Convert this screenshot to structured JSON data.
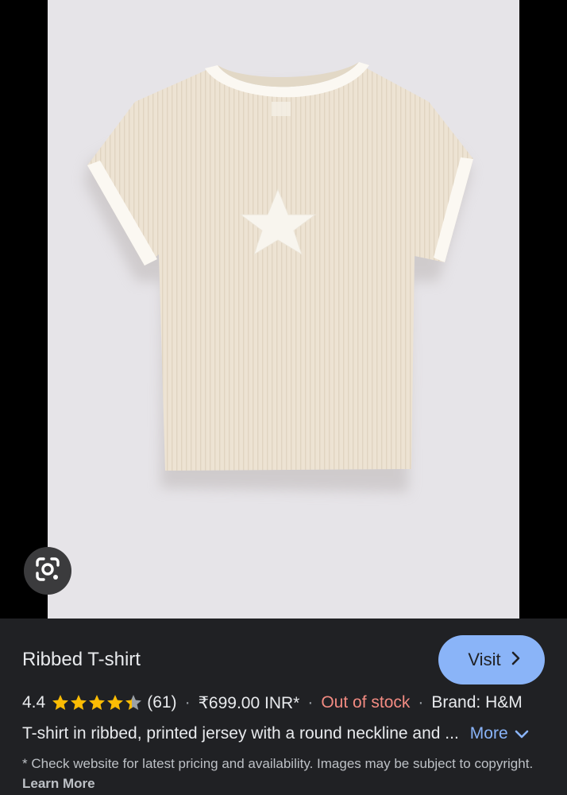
{
  "product": {
    "title": "Ribbed T-shirt",
    "visit_label": "Visit",
    "rating": "4.4",
    "review_count": "(61)",
    "price": "₹699.00 INR*",
    "stock_status": "Out of stock",
    "brand": "Brand: H&M",
    "description": "T-shirt in ribbed, printed jersey with a round neckline and ...",
    "more_label": "More",
    "disclaimer": "* Check website for latest pricing and availability. Images may be subject to copyright.",
    "learn_more_label": "Learn More",
    "star_rating_value": 4.4,
    "star_rating_max": 5
  },
  "colors": {
    "accent": "#8ab4f8",
    "out_of_stock": "#f28b82",
    "star": "#fbbc04",
    "panel_bg": "#202124"
  },
  "icons": {
    "lens": "google-lens-icon",
    "visit_chevron": "chevron-right-icon",
    "more_chevron": "chevron-down-icon"
  },
  "separator": "·"
}
